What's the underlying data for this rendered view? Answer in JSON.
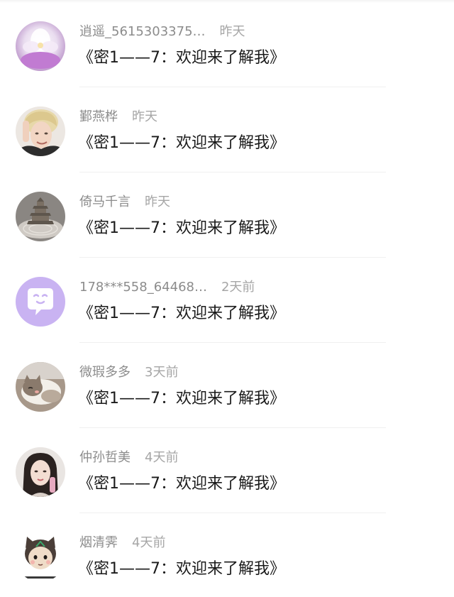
{
  "conversations": [
    {
      "name": "逍遥_5615303375…",
      "time": "昨天",
      "message": "《密1——7：欢迎来了解我》",
      "avatar_icon": "flower-avatar-icon"
    },
    {
      "name": "鄞燕桦",
      "time": "昨天",
      "message": "《密1——7：欢迎来了解我》",
      "avatar_icon": "blonde-man-avatar-icon"
    },
    {
      "name": "倚马千言",
      "time": "昨天",
      "message": "《密1——7：欢迎来了解我》",
      "avatar_icon": "pagoda-sand-avatar-icon"
    },
    {
      "name": "178***558_64468…",
      "time": "2天前",
      "message": "《密1——7：欢迎来了解我》",
      "avatar_icon": "chat-bubble-default-avatar-icon"
    },
    {
      "name": "微瑕多多",
      "time": "3天前",
      "message": "《密1——7：欢迎来了解我》",
      "avatar_icon": "cat-avatar-icon"
    },
    {
      "name": "仲孙哲美",
      "time": "4天前",
      "message": "《密1——7：欢迎来了解我》",
      "avatar_icon": "woman-portrait-avatar-icon"
    },
    {
      "name": "烟清霁",
      "time": "4天前",
      "message": "《密1——7：欢迎来了解我》",
      "avatar_icon": "cartoon-girl-avatar-icon"
    }
  ],
  "colors": {
    "name_text": "#8c8c8c",
    "time_text": "#a6a6a6",
    "message_text": "#1a1a1a",
    "divider": "#f0f0f0",
    "default_avatar_bg": "#c9b3f2"
  }
}
